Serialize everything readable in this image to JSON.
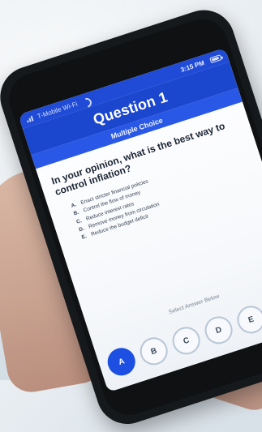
{
  "status": {
    "carrier": "T-Mobile Wi-Fi",
    "time": "3:15 PM"
  },
  "header": {
    "title": "Question 1",
    "subtitle": "Multiple Choice"
  },
  "question": {
    "text": "In your opinion, what is the best way to control inflation?"
  },
  "options": [
    {
      "key": "A.",
      "text": "Enact stricter financial policies"
    },
    {
      "key": "B.",
      "text": "Control the flow of money"
    },
    {
      "key": "C.",
      "text": "Reduce interest rates"
    },
    {
      "key": "D.",
      "text": "Remove money from circulation"
    },
    {
      "key": "E.",
      "text": "Reduce the budget deficit"
    }
  ],
  "answer": {
    "prompt": "Select Answer Below",
    "choices": [
      "A",
      "B",
      "C",
      "D",
      "E"
    ],
    "selected": "A"
  },
  "colors": {
    "primary": "#1b47cf"
  },
  "icons": [
    "signal-icon",
    "wifi-icon",
    "battery-icon"
  ]
}
